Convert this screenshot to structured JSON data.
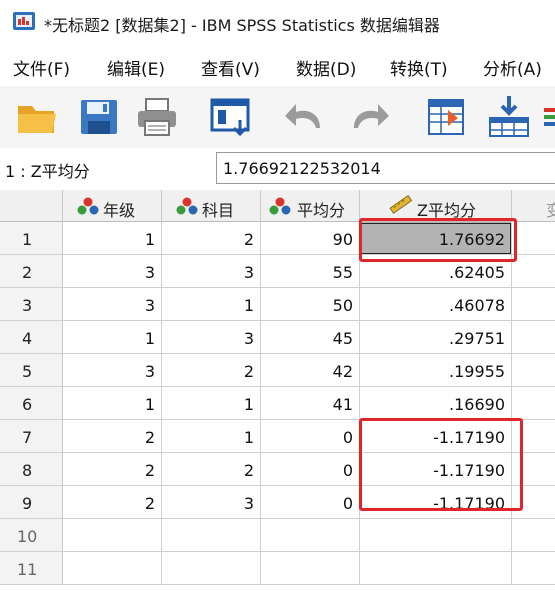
{
  "window": {
    "title": "*无标题2 [数据集2] - IBM SPSS Statistics 数据编辑器"
  },
  "menu": {
    "items": [
      "文件(F)",
      "编辑(E)",
      "查看(V)",
      "数据(D)",
      "转换(T)",
      "分析(A)"
    ]
  },
  "toolbar": {
    "icons": [
      "open-folder-icon",
      "save-icon",
      "print-icon",
      "dialog-recall-icon",
      "undo-icon",
      "redo-icon",
      "goto-case-icon",
      "goto-variable-icon",
      "variables-icon"
    ]
  },
  "cell_editor": {
    "reference": "1 : Z平均分",
    "value": "1.76692122532014"
  },
  "grid": {
    "columns": [
      "年级",
      "科目",
      "平均分",
      "Z平均分"
    ],
    "rows": [
      {
        "num": "1",
        "cells": [
          "1",
          "2",
          "90",
          "1.76692"
        ]
      },
      {
        "num": "2",
        "cells": [
          "3",
          "3",
          "55",
          ".62405"
        ]
      },
      {
        "num": "3",
        "cells": [
          "3",
          "1",
          "50",
          ".46078"
        ]
      },
      {
        "num": "4",
        "cells": [
          "1",
          "3",
          "45",
          ".29751"
        ]
      },
      {
        "num": "5",
        "cells": [
          "3",
          "2",
          "42",
          ".19955"
        ]
      },
      {
        "num": "6",
        "cells": [
          "1",
          "1",
          "41",
          ".16690"
        ]
      },
      {
        "num": "7",
        "cells": [
          "2",
          "1",
          "0",
          "-1.17190"
        ]
      },
      {
        "num": "8",
        "cells": [
          "2",
          "2",
          "0",
          "-1.17190"
        ]
      },
      {
        "num": "9",
        "cells": [
          "2",
          "3",
          "0",
          "-1.17190"
        ]
      },
      {
        "num": "10",
        "cells": [
          "",
          "",
          "",
          ""
        ]
      },
      {
        "num": "11",
        "cells": [
          "",
          "",
          "",
          ""
        ]
      }
    ]
  },
  "colors": {
    "highlight_box": "#e0262a",
    "selected_cell": "#b3b3b3",
    "header_bg": "#f0f0f0"
  }
}
